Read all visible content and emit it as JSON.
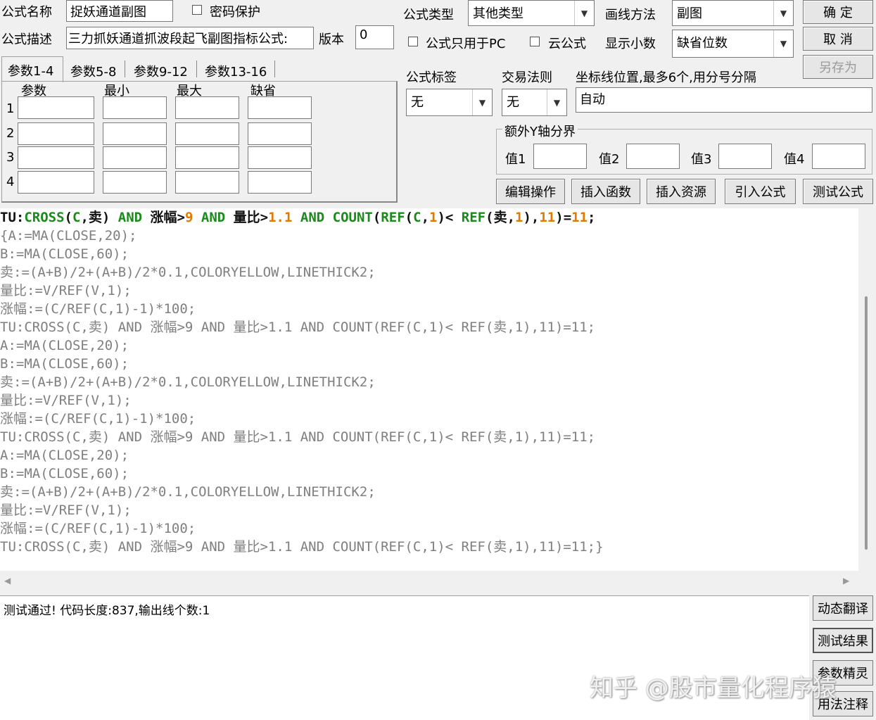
{
  "header": {
    "name_label": "公式名称",
    "name_value": "捉妖通道副图",
    "password_label": "密码保护",
    "desc_label": "公式描述",
    "desc_value": "三力抓妖通道抓波段起飞副图指标公式:",
    "version_label": "版本",
    "version_value": "0",
    "type_label": "公式类型",
    "type_value": "其他类型",
    "draw_label": "画线方法",
    "draw_value": "副图",
    "pc_only_label": "公式只用于PC",
    "cloud_label": "云公式",
    "decimal_label": "显示小数",
    "decimal_value": "缺省位数",
    "tag_label": "公式标签",
    "tag_value": "无",
    "trade_label": "交易法则",
    "trade_value": "无",
    "axis_label": "坐标线位置,最多6个,用分号分隔",
    "axis_value": "自动",
    "ybound_label": "额外Y轴分界",
    "val1": "值1",
    "val2": "值2",
    "val3": "值3",
    "val4": "值4"
  },
  "buttons": {
    "ok": "确 定",
    "cancel": "取 消",
    "save_as": "另存为",
    "edit": "编辑操作",
    "insert_func": "插入函数",
    "insert_res": "插入资源",
    "import": "引入公式",
    "test": "测试公式",
    "dyn_trans": "动态翻译",
    "test_result": "测试结果",
    "param_wizard": "参数精灵",
    "usage": "用法注释"
  },
  "tabs": [
    "参数1-4",
    "参数5-8",
    "参数9-12",
    "参数13-16"
  ],
  "param_columns": [
    "参数",
    "最小",
    "最大",
    "缺省"
  ],
  "param_rows": [
    "1",
    "2",
    "3",
    "4"
  ],
  "code_first": {
    "p1": "TU:",
    "p2": "CROSS",
    "p3": "(",
    "p4": "C",
    "p5": ",卖) ",
    "p6": "AND",
    "p7": " 涨幅>",
    "p8": "9",
    "p9": " ",
    "p10": "AND",
    "p11": " 量比>",
    "p12": "1.1",
    "p13": " ",
    "p14": "AND",
    "p15": " ",
    "p16": "COUNT",
    "p17": "(",
    "p18": "REF",
    "p19": "(",
    "p20": "C",
    "p21": ",",
    "p22": "1",
    "p23": ")< ",
    "p24": "REF",
    "p25": "(卖,",
    "p26": "1",
    "p27": "),",
    "p28": "11",
    "p29": ")=",
    "p30": "11",
    "p31": ";"
  },
  "code_lines": [
    "{A:=MA(CLOSE,20);",
    "B:=MA(CLOSE,60);",
    "卖:=(A+B)/2+(A+B)/2*0.1,COLORYELLOW,LINETHICK2;",
    "量比:=V/REF(V,1);",
    "涨幅:=(C/REF(C,1)-1)*100;",
    "TU:CROSS(C,卖) AND 涨幅>9 AND 量比>1.1 AND COUNT(REF(C,1)< REF(卖,1),11)=11;",
    "A:=MA(CLOSE,20);",
    "B:=MA(CLOSE,60);",
    "卖:=(A+B)/2+(A+B)/2*0.1,COLORYELLOW,LINETHICK2;",
    "量比:=V/REF(V,1);",
    "涨幅:=(C/REF(C,1)-1)*100;",
    "TU:CROSS(C,卖) AND 涨幅>9 AND 量比>1.1 AND COUNT(REF(C,1)< REF(卖,1),11)=11;",
    "A:=MA(CLOSE,20);",
    "B:=MA(CLOSE,60);",
    "卖:=(A+B)/2+(A+B)/2*0.1,COLORYELLOW,LINETHICK2;",
    "量比:=V/REF(V,1);",
    "涨幅:=(C/REF(C,1)-1)*100;",
    "TU:CROSS(C,卖) AND 涨幅>9 AND 量比>1.1 AND COUNT(REF(C,1)< REF(卖,1),11)=11;}"
  ],
  "result_text": "测试通过! 代码长度:837,输出线个数:1",
  "watermark": "知乎 @股市量化程序猿",
  "icons": {
    "dropdown": "chevron-down-icon",
    "scroll_left": "arrow-left-icon",
    "scroll_right": "arrow-right-icon"
  }
}
